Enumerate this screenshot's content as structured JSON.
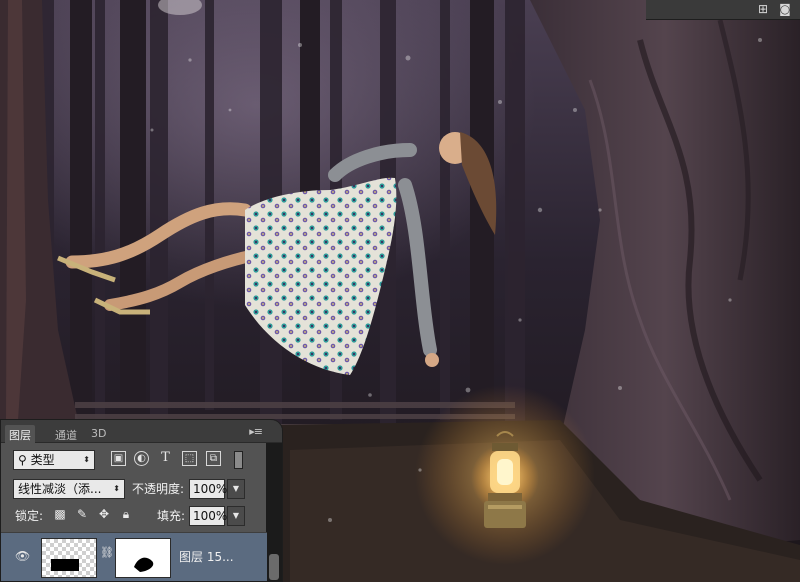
{
  "panel": {
    "tabs": [
      {
        "label": "图层"
      },
      {
        "label": "通道"
      },
      {
        "label": "3D"
      }
    ],
    "tab_menu_icon": "menu-lines-icon",
    "filter": {
      "kind_label": "类型",
      "icons": [
        "image-icon",
        "adjustment-circle-icon",
        "type-T-icon",
        "shape-icon",
        "smart-object-icon"
      ]
    },
    "blend": {
      "mode_value": "线性减淡（添...",
      "opacity_label": "不透明度:",
      "opacity_value": "100%"
    },
    "lock": {
      "label": "锁定:",
      "icons": [
        "lock-transparency-icon",
        "lock-brush-icon",
        "lock-move-icon",
        "lock-all-icon"
      ],
      "fill_label": "填充:",
      "fill_value": "100%"
    },
    "layer": {
      "name": "图层 15...",
      "visible": true
    }
  },
  "colors": {
    "panel_bg": "#535353",
    "layer_selected": "#5b6b80",
    "lantern_glow": "#ffd27a"
  }
}
